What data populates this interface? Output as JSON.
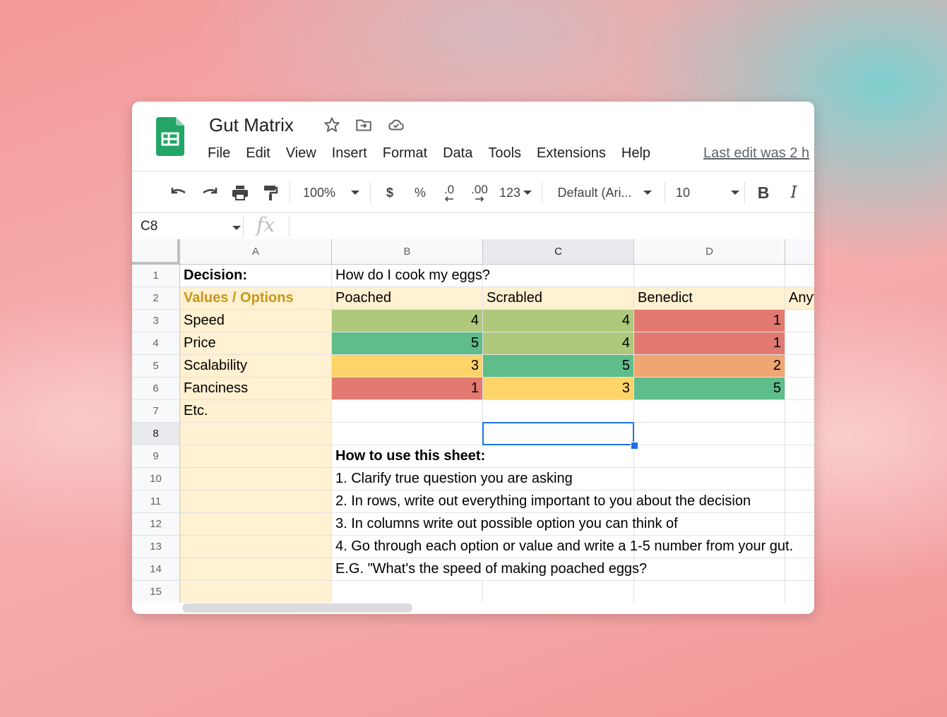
{
  "doc": {
    "title": "Gut Matrix",
    "menu": [
      "File",
      "Edit",
      "View",
      "Insert",
      "Format",
      "Data",
      "Tools",
      "Extensions",
      "Help"
    ],
    "last_edit": "Last edit was 2 h"
  },
  "toolbar": {
    "zoom": "100%",
    "currency": "$",
    "percent": "%",
    "decimal_less": ".0",
    "decimal_more": ".00",
    "number_format": "123",
    "font": "Default (Ari...",
    "font_size": "10",
    "bold": "B",
    "italic": "I"
  },
  "formula_bar": {
    "cell_ref": "C8",
    "fx": "fx"
  },
  "sheet": {
    "columns": [
      "A",
      "B",
      "C",
      "D"
    ],
    "rows": [
      "1",
      "2",
      "3",
      "4",
      "5",
      "6",
      "7",
      "8",
      "9",
      "10",
      "11",
      "12",
      "13",
      "14",
      "15"
    ],
    "selected_column": "C",
    "selected_row": "8",
    "colors": {
      "green_light": "#aec97b",
      "green": "#5ebd8b",
      "yellow": "#fdd46a",
      "red": "#e27a72",
      "orange": "#f0a673",
      "tan": "#fff1d1",
      "gold_text": "#c8961b"
    },
    "cells": {
      "A1": "Decision:",
      "B1": "How do I cook my eggs?",
      "A2": "Values / Options",
      "B2": "Poached",
      "C2": "Scrabled",
      "D2": "Benedict",
      "E2": "Anyt",
      "A3": "Speed",
      "B3": "4",
      "C3": "4",
      "D3": "1",
      "A4": "Price",
      "B4": "5",
      "C4": "4",
      "D4": "1",
      "A5": "Scalability",
      "B5": "3",
      "C5": "5",
      "D5": "2",
      "A6": "Fanciness",
      "B6": "1",
      "C6": "3",
      "D6": "5",
      "A7": "Etc.",
      "B9": "How to use this sheet:",
      "B10": "1. Clarify true question you are asking",
      "B11": "2. In rows, write out everything important to you about the decision",
      "B12": "3. In columns write out possible option you can think of",
      "B13": "4. Go through each option or value and write a 1-5 number from your gut.",
      "B14": "E.G. \"What's the speed of making poached eggs?"
    }
  }
}
